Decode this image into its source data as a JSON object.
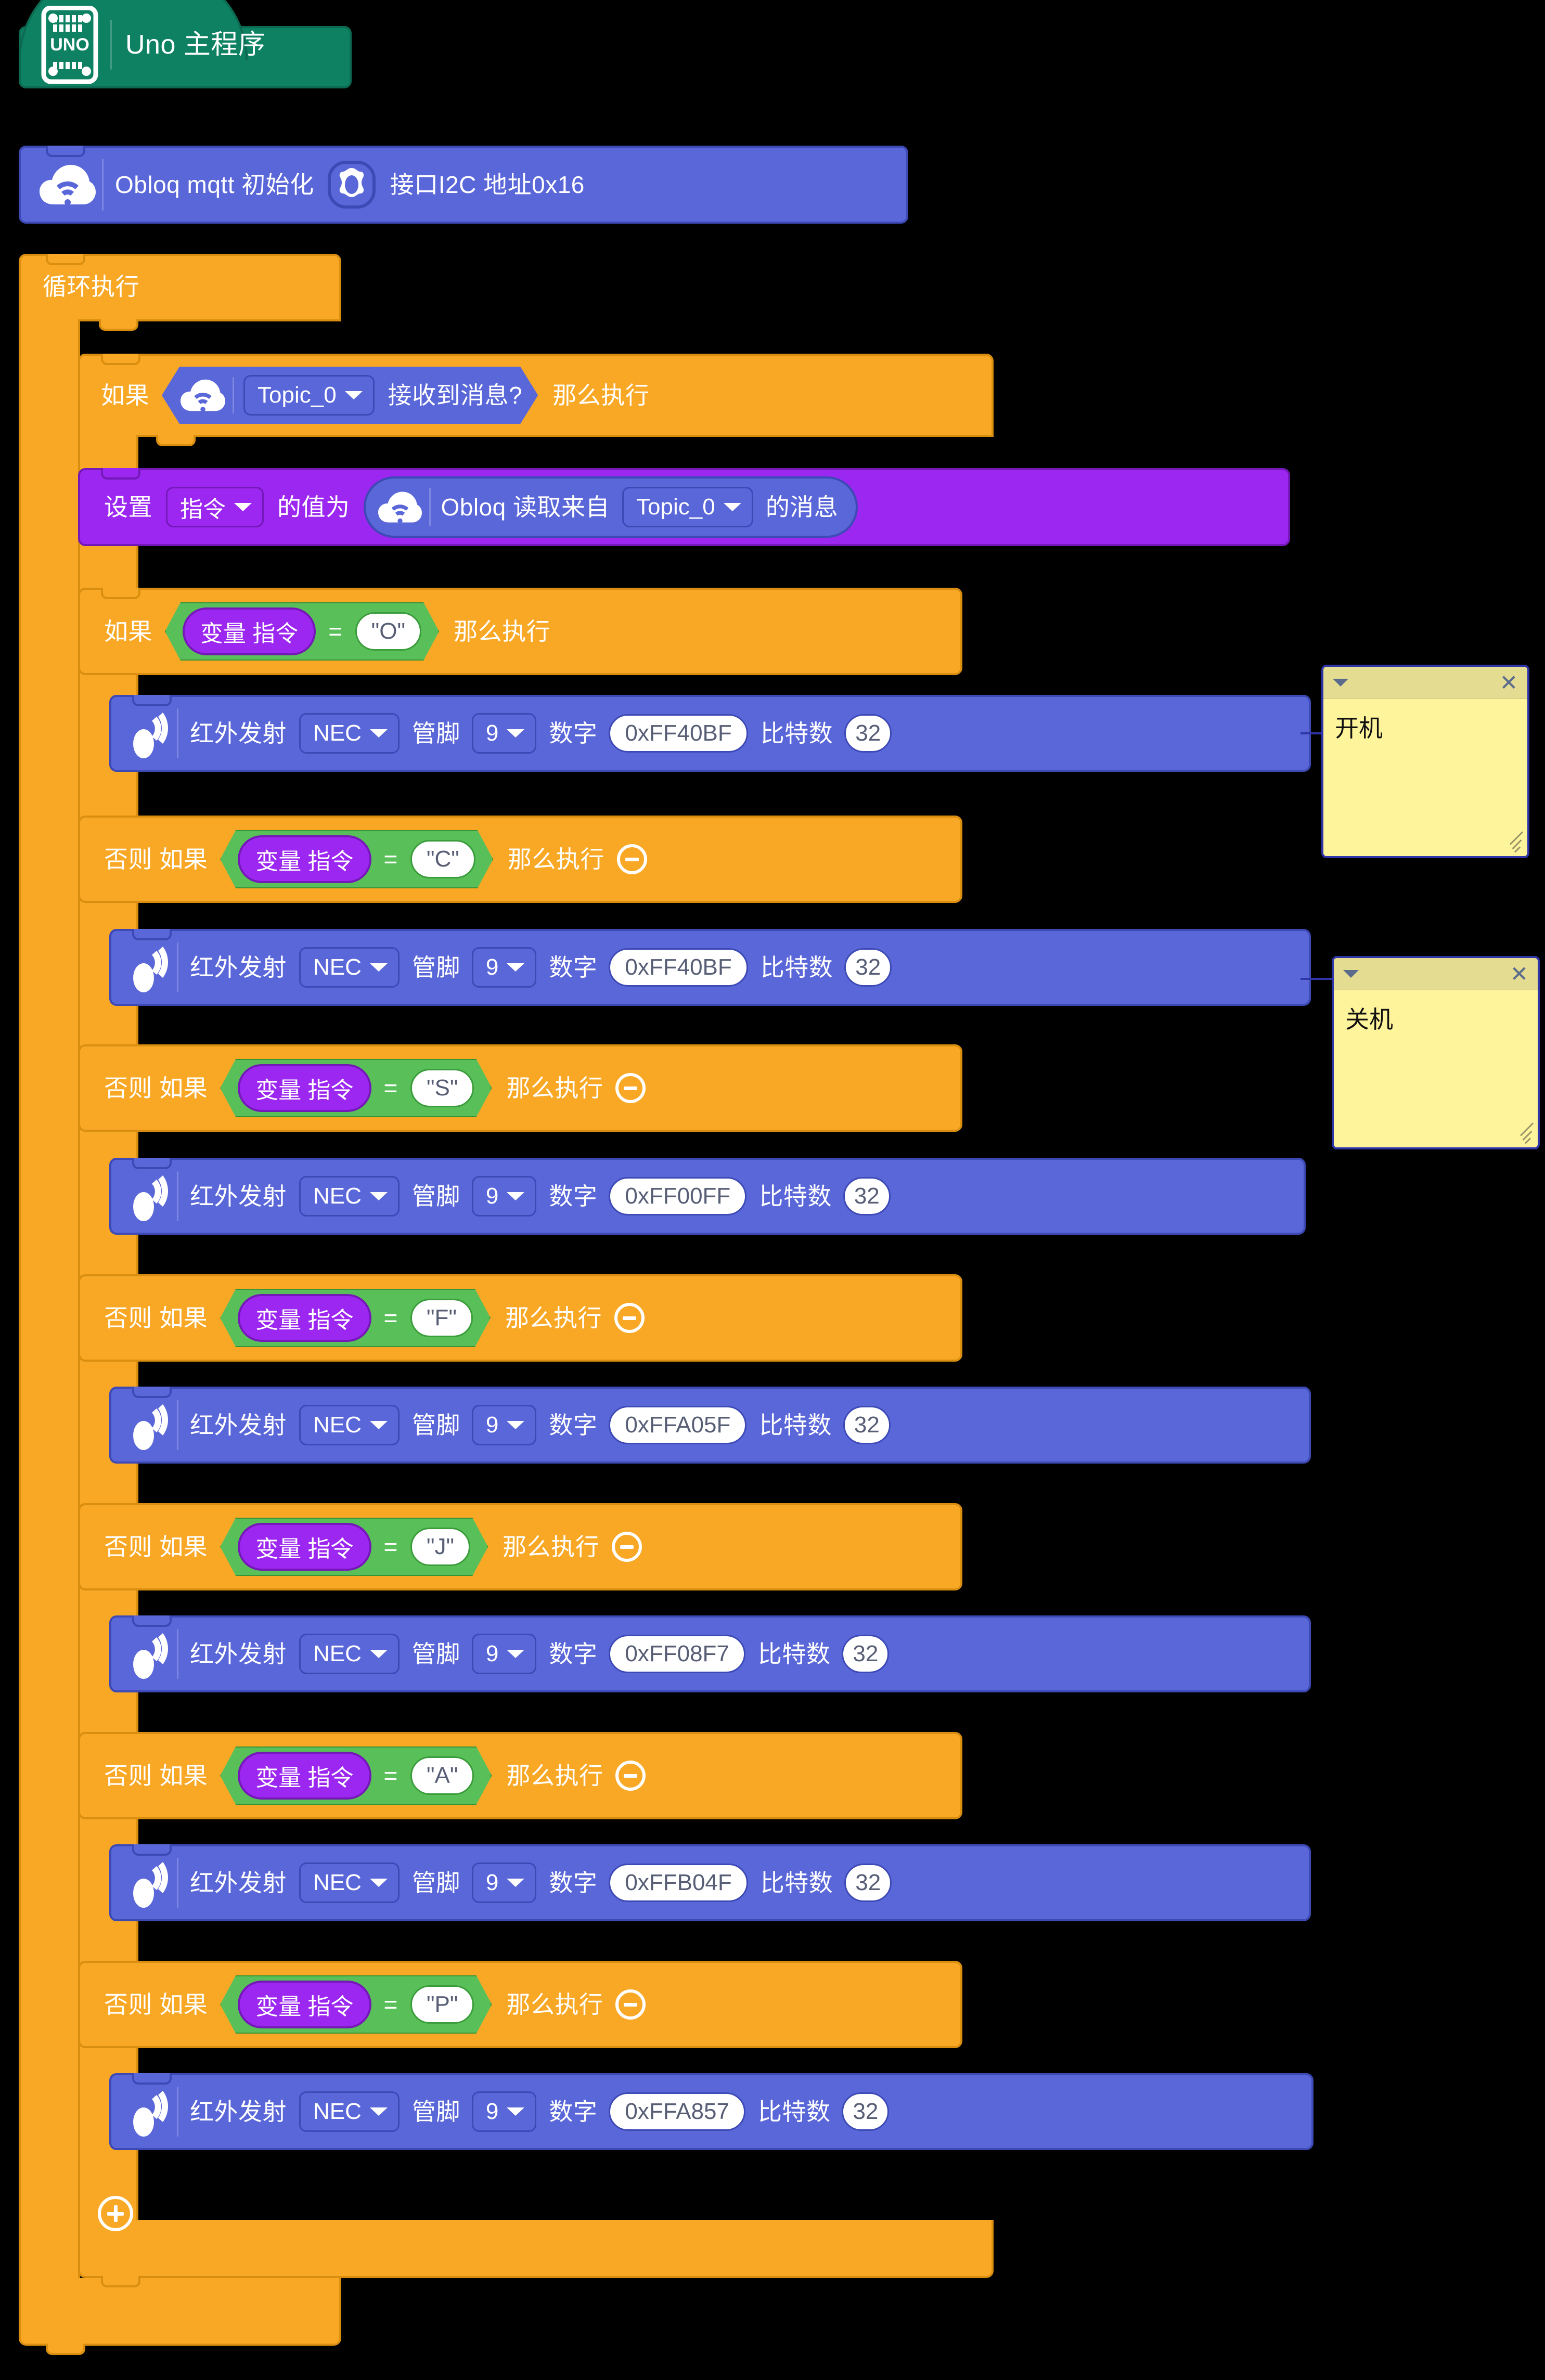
{
  "program": {
    "hat": {
      "label": "Uno 主程序",
      "icon": "uno-board-icon"
    },
    "init": {
      "label": "Obloq mqtt 初始化",
      "icon": "cloud-wifi-icon",
      "gear_icon": "gear-icon",
      "param": "接口I2C 地址0x16"
    },
    "forever": {
      "label": "循环执行"
    },
    "if_received": {
      "if_label": "如果",
      "icon": "cloud-wifi-icon",
      "topic": "Topic_0",
      "received_label": "接收到消息?",
      "then_label": "那么执行"
    },
    "set_var": {
      "set_label": "设置",
      "variable": "指令",
      "value_label": "的值为",
      "reader": {
        "icon": "cloud-wifi-icon",
        "prefix": "Obloq 读取来自",
        "topic": "Topic_0",
        "suffix": "的消息"
      }
    },
    "branches": [
      {
        "if_label": "如果",
        "variable_label": "变量 指令",
        "operator": "=",
        "value": "\"O\"",
        "then_label": "那么执行",
        "has_minus": false,
        "action": {
          "icon": "ir-emit-icon",
          "label": "红外发射",
          "protocol": "NEC",
          "pin_label": "管脚",
          "pin": "9",
          "number_label": "数字",
          "code": "0xFF40BF",
          "bits_label": "比特数",
          "bits": "32"
        }
      },
      {
        "if_label": "否则 如果",
        "variable_label": "变量 指令",
        "operator": "=",
        "value": "\"C\"",
        "then_label": "那么执行",
        "has_minus": true,
        "action": {
          "icon": "ir-emit-icon",
          "label": "红外发射",
          "protocol": "NEC",
          "pin_label": "管脚",
          "pin": "9",
          "number_label": "数字",
          "code": "0xFF40BF",
          "bits_label": "比特数",
          "bits": "32"
        }
      },
      {
        "if_label": "否则 如果",
        "variable_label": "变量 指令",
        "operator": "=",
        "value": "\"S\"",
        "then_label": "那么执行",
        "has_minus": true,
        "action": {
          "icon": "ir-emit-icon",
          "label": "红外发射",
          "protocol": "NEC",
          "pin_label": "管脚",
          "pin": "9",
          "number_label": "数字",
          "code": "0xFF00FF",
          "bits_label": "比特数",
          "bits": "32"
        }
      },
      {
        "if_label": "否则 如果",
        "variable_label": "变量 指令",
        "operator": "=",
        "value": "\"F\"",
        "then_label": "那么执行",
        "has_minus": true,
        "action": {
          "icon": "ir-emit-icon",
          "label": "红外发射",
          "protocol": "NEC",
          "pin_label": "管脚",
          "pin": "9",
          "number_label": "数字",
          "code": "0xFFA05F",
          "bits_label": "比特数",
          "bits": "32"
        }
      },
      {
        "if_label": "否则 如果",
        "variable_label": "变量 指令",
        "operator": "=",
        "value": "\"J\"",
        "then_label": "那么执行",
        "has_minus": true,
        "action": {
          "icon": "ir-emit-icon",
          "label": "红外发射",
          "protocol": "NEC",
          "pin_label": "管脚",
          "pin": "9",
          "number_label": "数字",
          "code": "0xFF08F7",
          "bits_label": "比特数",
          "bits": "32"
        }
      },
      {
        "if_label": "否则 如果",
        "variable_label": "变量 指令",
        "operator": "=",
        "value": "\"A\"",
        "then_label": "那么执行",
        "has_minus": true,
        "action": {
          "icon": "ir-emit-icon",
          "label": "红外发射",
          "protocol": "NEC",
          "pin_label": "管脚",
          "pin": "9",
          "number_label": "数字",
          "code": "0xFFB04F",
          "bits_label": "比特数",
          "bits": "32"
        }
      },
      {
        "if_label": "否则 如果",
        "variable_label": "变量 指令",
        "operator": "=",
        "value": "\"P\"",
        "then_label": "那么执行",
        "has_minus": true,
        "action": {
          "icon": "ir-emit-icon",
          "label": "红外发射",
          "protocol": "NEC",
          "pin_label": "管脚",
          "pin": "9",
          "number_label": "数字",
          "code": "0xFFA857",
          "bits_label": "比特数",
          "bits": "32"
        }
      }
    ],
    "add_branch_button": {
      "icon": "plus-icon"
    },
    "comments": [
      {
        "text": "开机",
        "collapse_icon": "chevron-down-icon",
        "close_icon": "close-icon"
      },
      {
        "text": "关机",
        "collapse_icon": "chevron-down-icon",
        "close_icon": "close-icon"
      }
    ]
  },
  "colors": {
    "hat": "#0e8162",
    "blue": "#5a67d8",
    "orange": "#f9a825",
    "purple": "#9c27f0",
    "green": "#59c059",
    "comment": "#fef49c"
  }
}
